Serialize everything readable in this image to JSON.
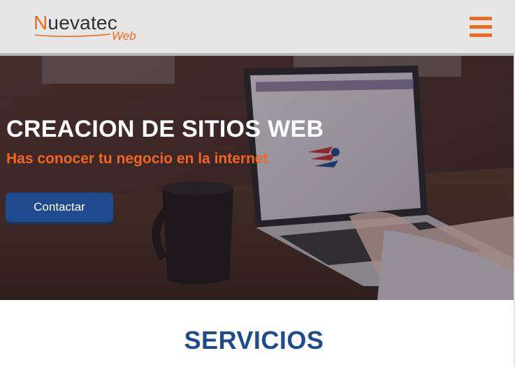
{
  "header": {
    "brand_name": "Nuevatec",
    "brand_first_letter": "N",
    "brand_rest": "uevatec",
    "brand_sub": "Web",
    "menu_icon": "hamburger-menu-icon"
  },
  "hero": {
    "title": "CREACION DE SITIOS WEB",
    "subtitle": "Has conocer tu negocio en la internet",
    "cta_label": "Contactar"
  },
  "services": {
    "title": "SERVICIOS"
  },
  "colors": {
    "accent_orange": "#ec6a1c",
    "brand_blue": "#1f4b8e",
    "header_bg": "#e6e6e6"
  }
}
